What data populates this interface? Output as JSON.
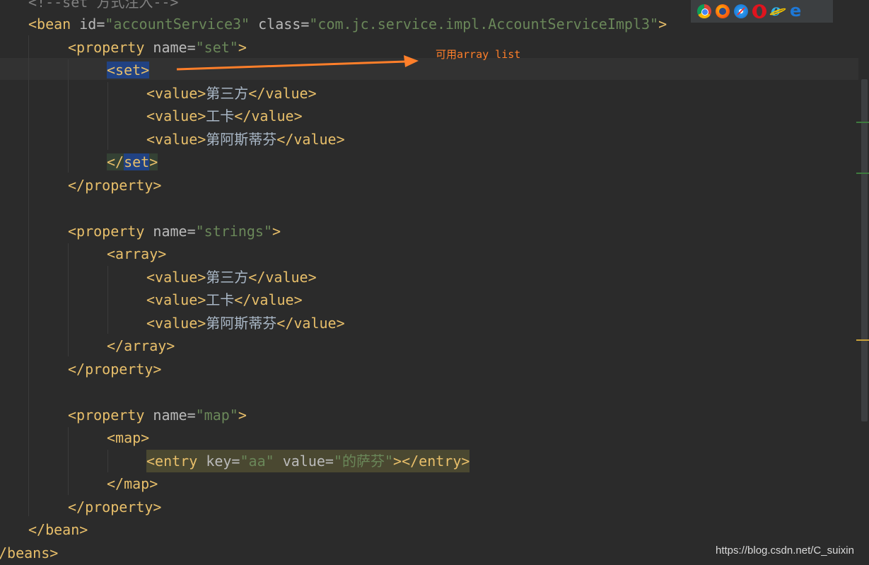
{
  "code_lines": {
    "l0": {
      "open": "<!--",
      "text": "set 方式注入",
      "close": "-->"
    },
    "l1": {
      "lt": "<",
      "tag": "bean",
      "sp1": " ",
      "attr1": "id=",
      "val1": "\"accountService3\"",
      "sp2": " ",
      "attr2": "class=",
      "val2": "\"com.jc.service.impl.AccountServiceImpl3\"",
      "gt": ">"
    },
    "l2": {
      "lt": "<",
      "tag": "property",
      "sp": " ",
      "attr": "name=",
      "val": "\"set\"",
      "gt": ">"
    },
    "l3": {
      "text": "<set>"
    },
    "l4": {
      "open": "<value>",
      "text": "第三方",
      "close": "</value>"
    },
    "l5": {
      "open": "<value>",
      "text": "工卡",
      "close": "</value>"
    },
    "l6": {
      "open": "<value>",
      "text": "第阿斯蒂芬",
      "close": "</value>"
    },
    "l7": {
      "lt": "</",
      "tag": "set",
      "gt": ">"
    },
    "l8": {
      "text": "</property>"
    },
    "l10": {
      "lt": "<",
      "tag": "property",
      "sp": " ",
      "attr": "name=",
      "val": "\"strings\"",
      "gt": ">"
    },
    "l11": {
      "text": "<array>"
    },
    "l12": {
      "open": "<value>",
      "text": "第三方",
      "close": "</value>"
    },
    "l13": {
      "open": "<value>",
      "text": "工卡",
      "close": "</value>"
    },
    "l14": {
      "open": "<value>",
      "text": "第阿斯蒂芬",
      "close": "</value>"
    },
    "l15": {
      "text": "</array>"
    },
    "l16": {
      "text": "</property>"
    },
    "l18": {
      "lt": "<",
      "tag": "property",
      "sp": " ",
      "attr": "name=",
      "val": "\"map\"",
      "gt": ">"
    },
    "l19": {
      "text": "<map>"
    },
    "l20": {
      "lt": "<",
      "tag": "entry",
      "sp1": " ",
      "attr1": "key=",
      "val1": "\"aa\"",
      "sp2": " ",
      "attr2": "value=",
      "val2": "\"的萨芬\"",
      "gt": "></entry>"
    },
    "l21": {
      "text": "</map>"
    },
    "l22": {
      "text": "</property>"
    },
    "l23": {
      "text": "</bean>"
    },
    "l24": {
      "text": "/beans>"
    }
  },
  "annotation": {
    "note": "可用array list"
  },
  "watermark": "https://blog.csdn.net/C_suixin",
  "browser_icons": [
    "chrome-icon",
    "firefox-icon",
    "safari-icon",
    "opera-icon",
    "ie-icon",
    "edge-icon"
  ],
  "colors": {
    "background": "#2b2b2b",
    "tag": "#e8bf6a",
    "attribute": "#bababa",
    "value": "#6a8759",
    "text": "#a9b7c6",
    "annotation": "#ff7f2a"
  }
}
